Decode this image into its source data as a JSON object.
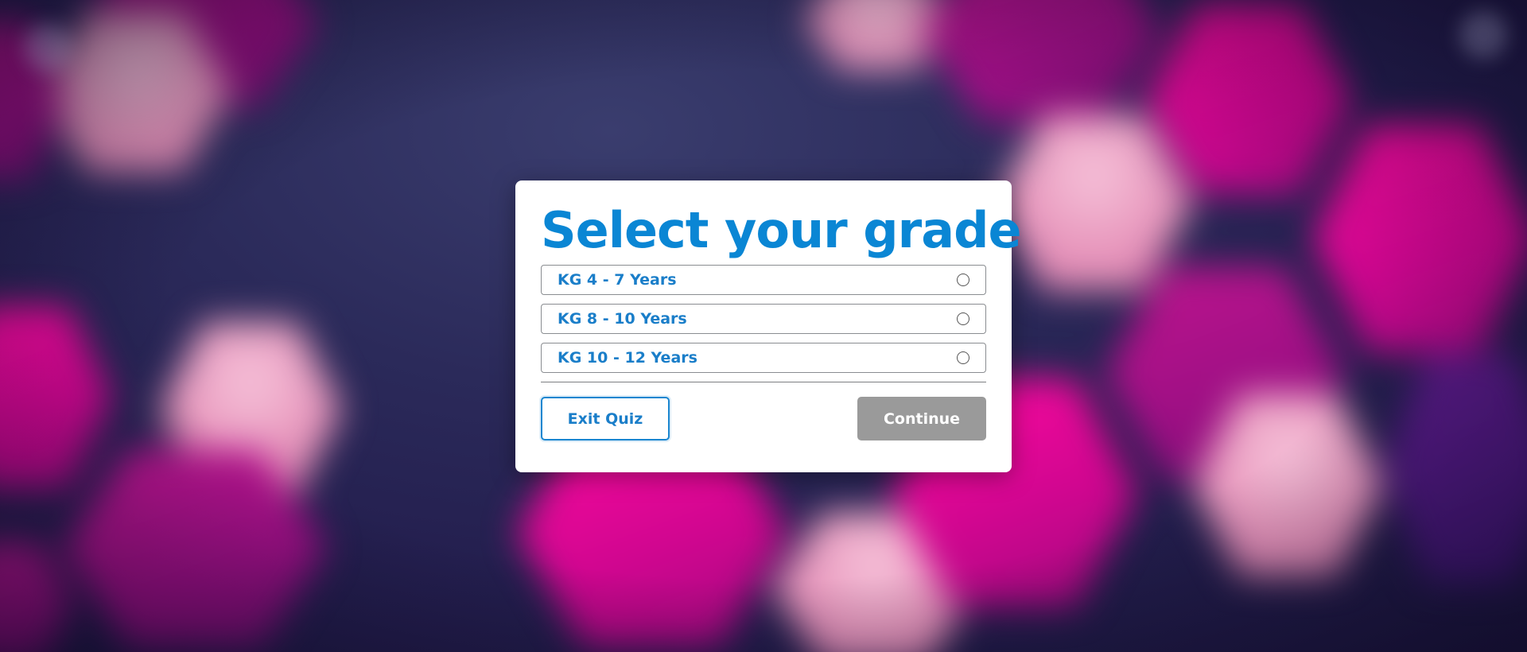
{
  "dialog": {
    "title": "Select your grade",
    "options": [
      {
        "label": "KG 4 - 7 Years"
      },
      {
        "label": "KG 8 - 10 Years"
      },
      {
        "label": "KG 10 - 12 Years"
      }
    ],
    "exit_label": "Exit Quiz",
    "continue_label": "Continue"
  },
  "colors": {
    "accent": "#0a86d4",
    "continue_disabled": "#9a9a9a",
    "background_dark": "#241f4f",
    "hex_pink": "#e99bbf",
    "hex_magenta": "#c0158f"
  },
  "icons": {
    "option_marker": "radio-unchecked-icon"
  }
}
